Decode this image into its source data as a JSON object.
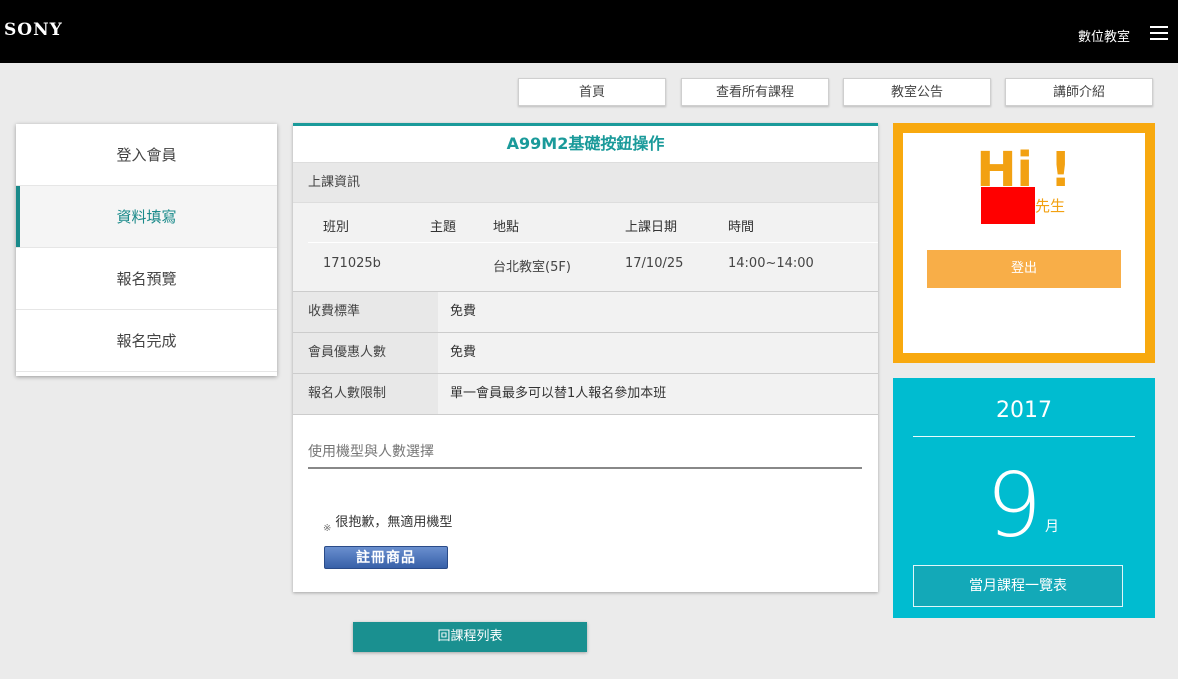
{
  "header": {
    "logo": "SONY",
    "site_name": "數位教室"
  },
  "nav": {
    "home": "首頁",
    "all_courses": "查看所有課程",
    "announcements": "教室公告",
    "instructors": "講師介紹"
  },
  "steps": [
    "登入會員",
    "資料填寫",
    "報名預覽",
    "報名完成"
  ],
  "active_step": 1,
  "course": {
    "title": "A99M2基礎按鈕操作",
    "section_title": "上課資訊",
    "schedule_headers": [
      "班別",
      "主題",
      "地點",
      "上課日期",
      "時間"
    ],
    "schedule_values": [
      "171025b",
      "",
      "台北教室(5F)",
      "17/10/25",
      "14:00~14:00"
    ],
    "fee_label": "收費標準",
    "fee_value": "免費",
    "member_label": "會員優惠人數",
    "member_value": "免費",
    "limit_label": "報名人數限制",
    "limit_value": "單一會員最多可以替1人報名參加本班",
    "model_select_label": "使用機型與人數選擇",
    "note_mark": "※",
    "note_text": "很抱歉，無適用機型",
    "register_button": "註冊商品"
  },
  "back_button": "回課程列表",
  "user": {
    "greeting": "Hi !",
    "honorific": "先生",
    "logout": "登出"
  },
  "calendar": {
    "year": "2017",
    "month": "9",
    "month_unit": "月",
    "month_courses_button": "當月課程一覽表"
  },
  "colors": {
    "teal": "#1a9a9a",
    "orange": "#f8a90f",
    "cyan": "#00bcd0",
    "redaction": "#ff0000"
  }
}
